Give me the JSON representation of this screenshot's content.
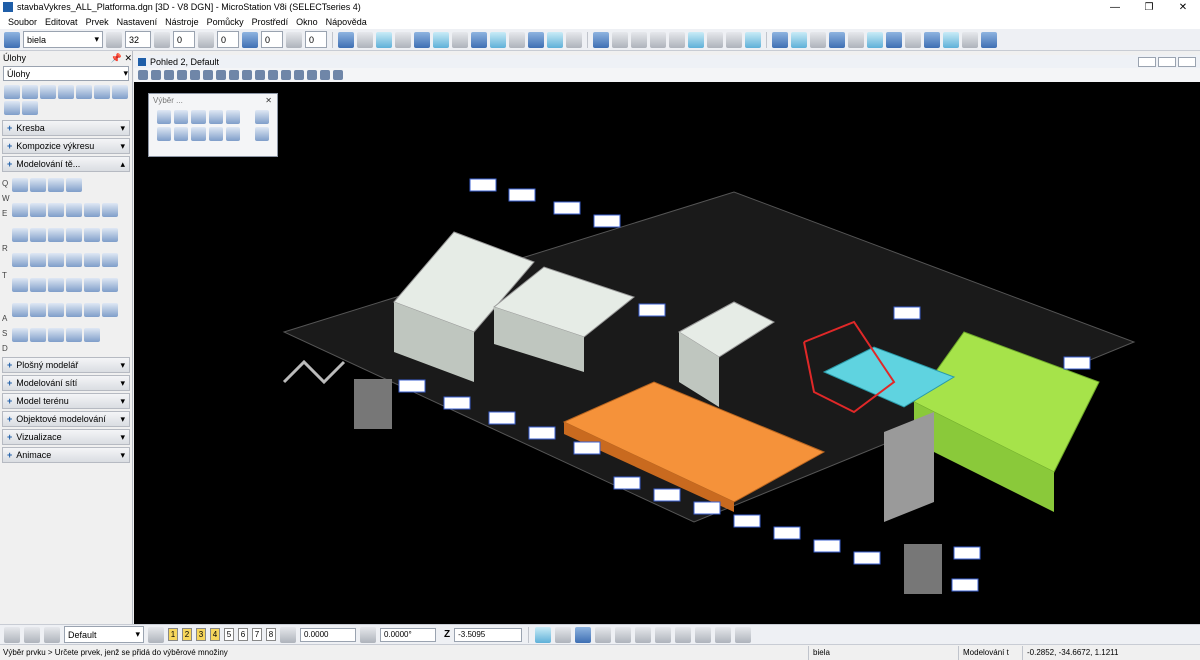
{
  "window": {
    "title": "stavbaVykres_ALL_Platforma.dgn [3D - V8 DGN] - MicroStation V8i (SELECTseries 4)"
  },
  "menu": [
    "Soubor",
    "Editovat",
    "Prvek",
    "Nastavení",
    "Nástroje",
    "Pomůcky",
    "Prostředí",
    "Okno",
    "Nápověda"
  ],
  "toolbar": {
    "color": "biela",
    "weight": "32",
    "style": "0",
    "level": "0",
    "transparency": "0",
    "priority": "0"
  },
  "tasks": {
    "title": "Úlohy",
    "selected": "Úlohy"
  },
  "sections": [
    {
      "label": "Kresba"
    },
    {
      "label": "Kompozice výkresu"
    },
    {
      "label": "Modelování tě..."
    }
  ],
  "section_rows": [
    "Q",
    "W",
    "E",
    "R",
    "T",
    "A",
    "S",
    "D"
  ],
  "lower_sections": [
    "Plošný modelář",
    "Modelování sítí",
    "Model terénu",
    "Objektové modelování",
    "Vizualizace",
    "Animace"
  ],
  "view": {
    "title": "Pohled 2, Default"
  },
  "dialog": {
    "title": "Výběr ..."
  },
  "bottom": {
    "model": "Default",
    "views": [
      "1",
      "2",
      "3",
      "4",
      "5",
      "6",
      "7",
      "8"
    ],
    "x": "0.0000",
    "angle": "0.0000°",
    "z_label": "Z",
    "z": "-3.5095"
  },
  "status": {
    "message": "Výběr prvku > Určete prvek, jenž se přidá do výběrové množiny",
    "color": "biela",
    "model": "Modelování t",
    "coords": "-0.2852, -34.6672, 1.1211"
  },
  "colors": {
    "background": "#000000",
    "accent": "#1f5ea8",
    "orange": "#f5923a",
    "green": "#a6e34a",
    "cyan": "#5fd3e0",
    "window_blue": "#3a5fd0"
  }
}
